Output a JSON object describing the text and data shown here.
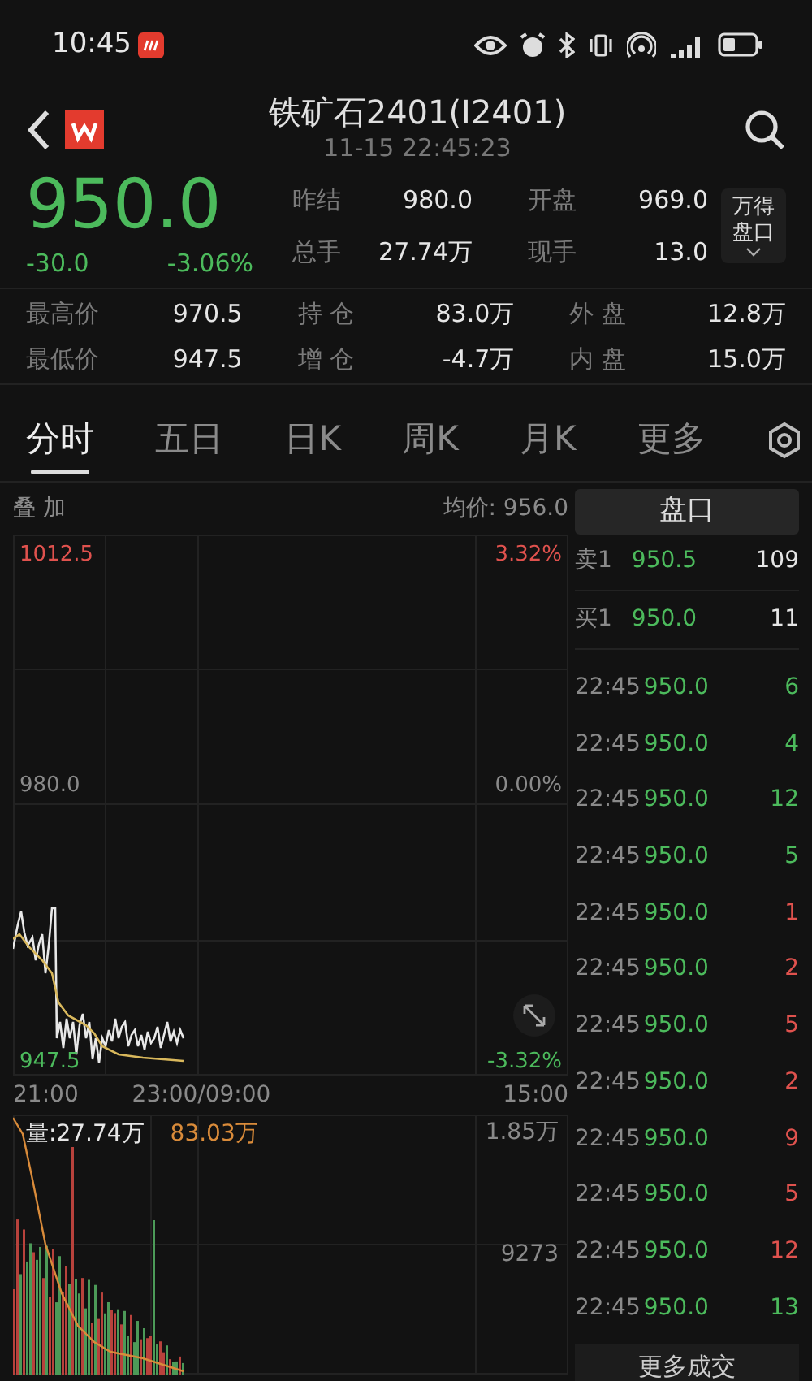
{
  "status_bar": {
    "time": "10:45"
  },
  "header": {
    "title": "铁矿石2401(I2401)",
    "timestamp": "11-15 22:45:23"
  },
  "quote": {
    "price": "950.0",
    "change": "-30.0",
    "change_pct": "-3.06%",
    "up": false
  },
  "stats": [
    {
      "label": "昨结",
      "value": "980.0"
    },
    {
      "label": "开盘",
      "value": "969.0"
    },
    {
      "label": "总手",
      "value": "27.74万"
    },
    {
      "label": "现手",
      "value": "13.0"
    }
  ],
  "side_button": {
    "lines": [
      "万得",
      "盘口"
    ]
  },
  "details": [
    {
      "label": "最高价",
      "value": "970.5"
    },
    {
      "label": "持 仓",
      "value": "83.0万"
    },
    {
      "label": "外 盘",
      "value": "12.8万"
    },
    {
      "label": "最低价",
      "value": "947.5"
    },
    {
      "label": "增 仓",
      "value": "-4.7万"
    },
    {
      "label": "内 盘",
      "value": "15.0万"
    }
  ],
  "tabs": [
    {
      "label": "分时",
      "selected": true
    },
    {
      "label": "五日",
      "selected": false
    },
    {
      "label": "日K",
      "selected": false
    },
    {
      "label": "周K",
      "selected": false
    },
    {
      "label": "月K",
      "selected": false
    },
    {
      "label": "更多",
      "selected": false
    }
  ],
  "chart": {
    "overlay_label": "叠 加",
    "avg_price": "均价: 956.0",
    "price_labels": [
      "1012.5",
      "980.0",
      "947.5"
    ],
    "pct_labels": [
      "3.32%",
      "0.00%",
      "-3.32%"
    ],
    "time_labels": [
      "21:00",
      "23:00/09:00",
      "15:00"
    ],
    "volume_label": "量:27.74万",
    "volume_ma": "83.03万",
    "volume_ticks": [
      "1.85万",
      "9273"
    ]
  },
  "order_book": {
    "title": "盘口",
    "levels": [
      {
        "side": "卖1",
        "price": "950.5",
        "qty": "109"
      },
      {
        "side": "买1",
        "price": "950.0",
        "qty": "11"
      }
    ],
    "trades": [
      {
        "time": "22:45",
        "price": "950.0",
        "qty": "6",
        "up": false
      },
      {
        "time": "22:45",
        "price": "950.0",
        "qty": "4",
        "up": false
      },
      {
        "time": "22:45",
        "price": "950.0",
        "qty": "12",
        "up": false
      },
      {
        "time": "22:45",
        "price": "950.0",
        "qty": "5",
        "up": false
      },
      {
        "time": "22:45",
        "price": "950.0",
        "qty": "1",
        "up": true
      },
      {
        "time": "22:45",
        "price": "950.0",
        "qty": "2",
        "up": true
      },
      {
        "time": "22:45",
        "price": "950.0",
        "qty": "5",
        "up": true
      },
      {
        "time": "22:45",
        "price": "950.0",
        "qty": "2",
        "up": true
      },
      {
        "time": "22:45",
        "price": "950.0",
        "qty": "9",
        "up": true
      },
      {
        "time": "22:45",
        "price": "950.0",
        "qty": "5",
        "up": true
      },
      {
        "time": "22:45",
        "price": "950.0",
        "qty": "12",
        "up": true
      },
      {
        "time": "22:45",
        "price": "950.0",
        "qty": "13",
        "up": false
      }
    ],
    "more_button": "更多成交"
  }
}
